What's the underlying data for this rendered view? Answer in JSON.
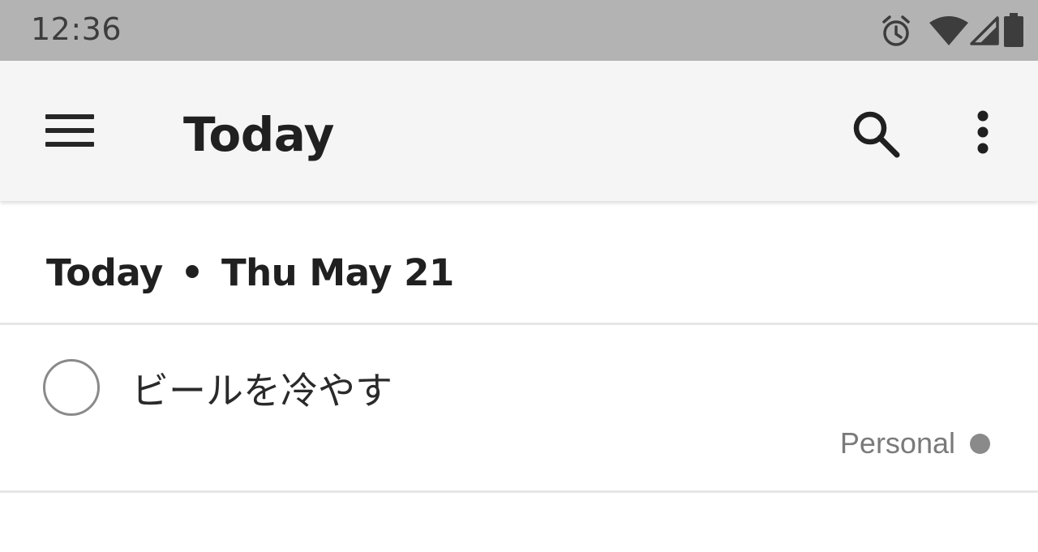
{
  "status_bar": {
    "time": "12:36",
    "icons": [
      "alarm-icon",
      "wifi-icon",
      "cell-signal-icon",
      "battery-icon"
    ]
  },
  "app_bar": {
    "title": "Today",
    "icons": [
      "menu-icon",
      "search-icon",
      "more-vert-icon"
    ]
  },
  "section": {
    "label": "Today",
    "separator": "•",
    "date": "Thu May 21"
  },
  "tasks": [
    {
      "title": "ビールを冷やす",
      "project": "Personal",
      "completed": false
    }
  ],
  "colors": {
    "status_bar_bg": "#b3b3b3",
    "app_bar_bg": "#f5f5f5",
    "project_dot": "#8a8a8a"
  }
}
